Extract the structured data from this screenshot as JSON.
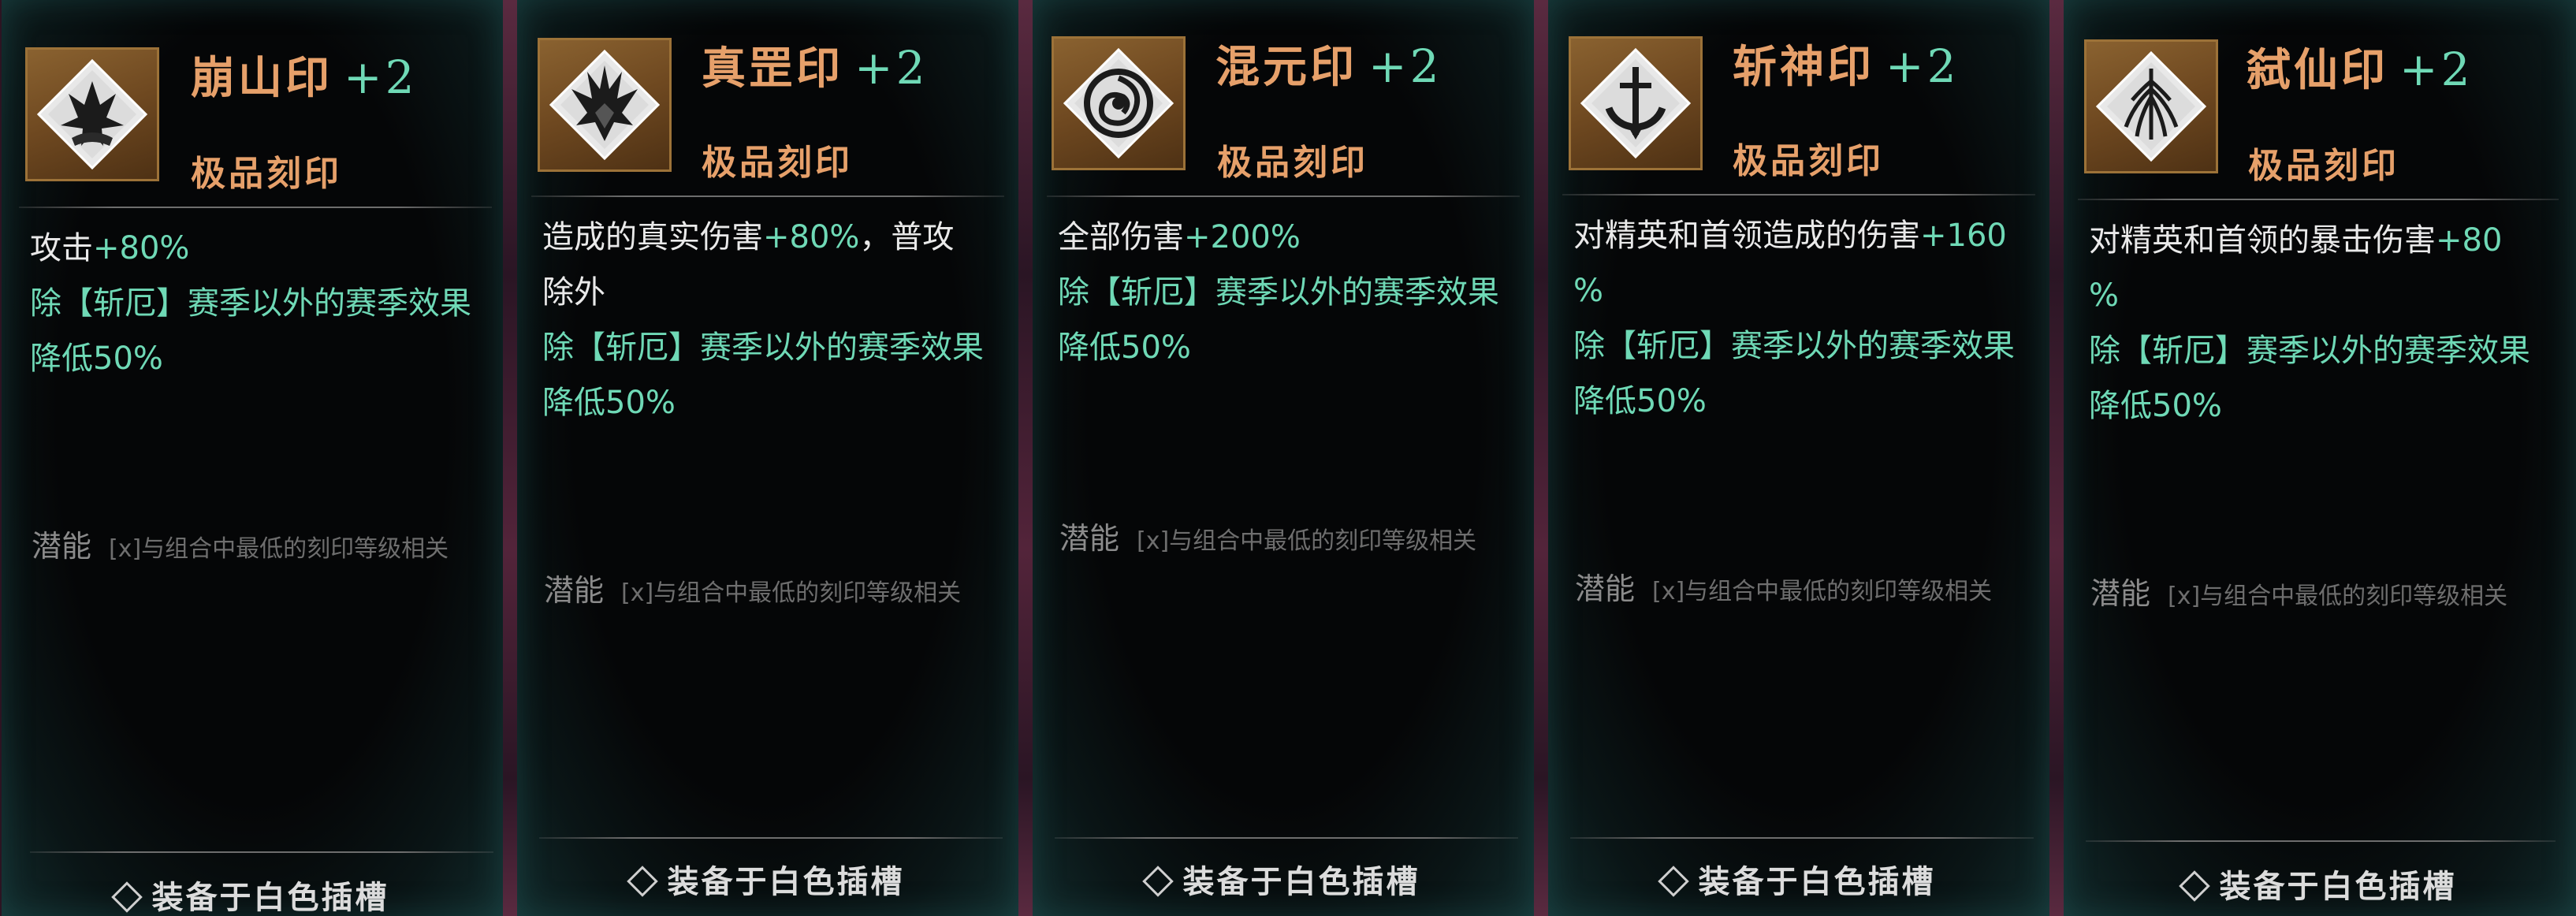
{
  "cards": [
    {
      "name": "崩山印",
      "level": "+2",
      "rarity": "极品刻印",
      "desc_lines": [
        [
          {
            "t": "攻击",
            "g": false
          },
          {
            "t": "+80%",
            "g": true
          }
        ],
        [
          {
            "t": "除【斩厄】赛季以外的赛季效果",
            "g": true
          }
        ],
        [
          {
            "t": "降低50%",
            "g": true
          }
        ]
      ],
      "potential_label": "潜能",
      "potential_desc": "[x]与组合中最低的刻印等级相关",
      "footer": "装备于白色插槽",
      "icon": "mountain-burst-icon"
    },
    {
      "name": "真罡印",
      "level": "+2",
      "rarity": "极品刻印",
      "desc_lines": [
        [
          {
            "t": "造成的真实伤害",
            "g": false
          },
          {
            "t": "+80%",
            "g": true
          },
          {
            "t": "，普攻",
            "g": false
          }
        ],
        [
          {
            "t": "除外",
            "g": false
          }
        ],
        [
          {
            "t": "除【斩厄】赛季以外的赛季效果",
            "g": true
          }
        ],
        [
          {
            "t": "降低50%",
            "g": true
          }
        ]
      ],
      "potential_label": "潜能",
      "potential_desc": "[x]与组合中最低的刻印等级相关",
      "footer": "装备于白色插槽",
      "icon": "flame-spikes-icon"
    },
    {
      "name": "混元印",
      "level": "+2",
      "rarity": "极品刻印",
      "desc_lines": [
        [
          {
            "t": "全部伤害",
            "g": false
          },
          {
            "t": "+200%",
            "g": true
          }
        ],
        [
          {
            "t": "除【斩厄】赛季以外的赛季效果",
            "g": true
          }
        ],
        [
          {
            "t": "降低50%",
            "g": true
          }
        ]
      ],
      "potential_label": "潜能",
      "potential_desc": "[x]与组合中最低的刻印等级相关",
      "footer": "装备于白色插槽",
      "icon": "swirl-orb-icon"
    },
    {
      "name": "斩神印",
      "level": "+2",
      "rarity": "极品刻印",
      "desc_lines": [
        [
          {
            "t": "对精英和首领造成的伤害",
            "g": false
          },
          {
            "t": "+160",
            "g": true
          }
        ],
        [
          {
            "t": "%",
            "g": true
          }
        ],
        [
          {
            "t": "除【斩厄】赛季以外的赛季效果",
            "g": true
          }
        ],
        [
          {
            "t": "降低50%",
            "g": true
          }
        ]
      ],
      "potential_label": "潜能",
      "potential_desc": "[x]与组合中最低的刻印等级相关",
      "footer": "装备于白色插槽",
      "icon": "sword-crescent-icon"
    },
    {
      "name": "弑仙印",
      "level": "+2",
      "rarity": "极品刻印",
      "desc_lines": [
        [
          {
            "t": "对精英和首领的暴击伤害",
            "g": false
          },
          {
            "t": "+80",
            "g": true
          }
        ],
        [
          {
            "t": "%",
            "g": true
          }
        ],
        [
          {
            "t": "除【斩厄】赛季以外的赛季效果",
            "g": true
          }
        ],
        [
          {
            "t": "降低50%",
            "g": true
          }
        ]
      ],
      "potential_label": "潜能",
      "potential_desc": "[x]与组合中最低的刻印等级相关",
      "footer": "装备于白色插槽",
      "icon": "feather-fan-icon"
    }
  ],
  "colors": {
    "title": "#e6a06a",
    "accent_green": "#6fd9b6",
    "text": "#e9e9e9",
    "muted": "#8b8b8b"
  }
}
